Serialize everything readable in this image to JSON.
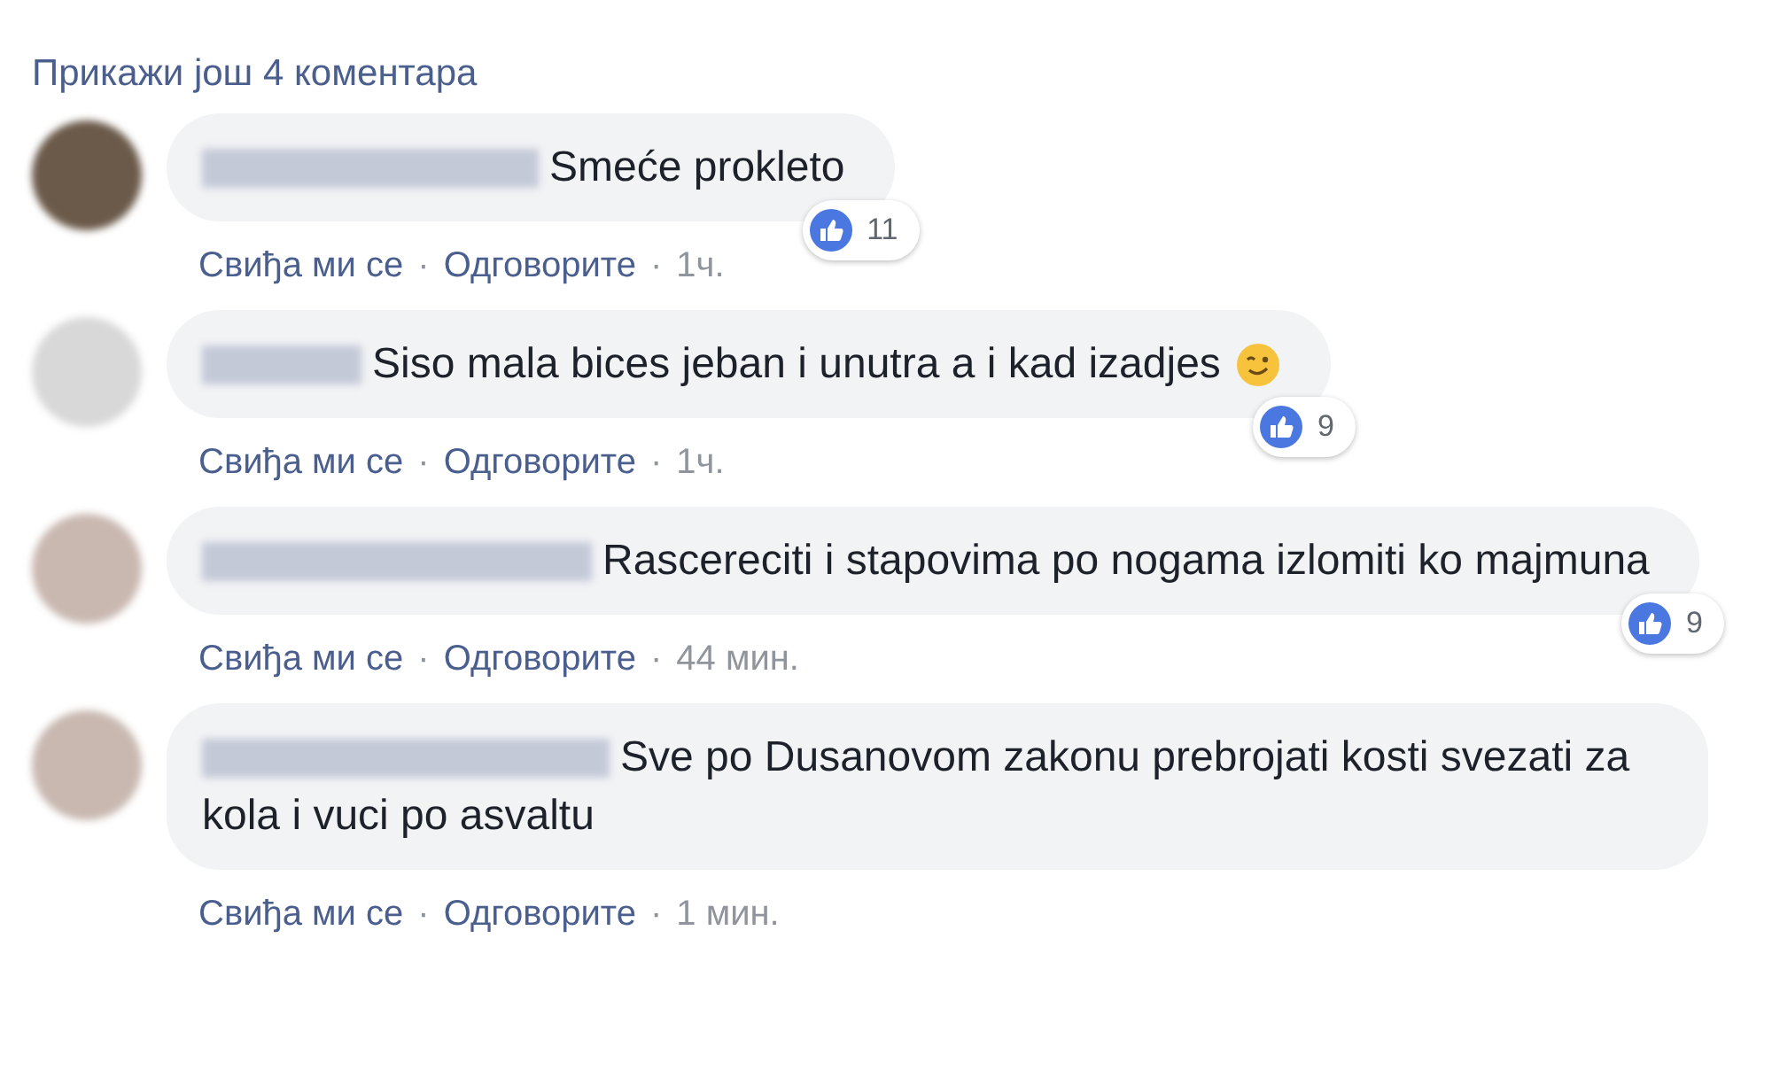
{
  "more_comments": "Прикажи још 4 коментара",
  "comments": [
    {
      "text": "Smeće prokleto",
      "wink_emoji": false,
      "likes": "11",
      "actions": [
        {
          "kind": "link",
          "text": "Свиђа ми се"
        },
        {
          "kind": "dot",
          "text": "·"
        },
        {
          "kind": "link",
          "text": "Одговорите"
        },
        {
          "kind": "dot",
          "text": "·"
        },
        {
          "kind": "time",
          "text": "1ч."
        }
      ]
    },
    {
      "text": "Siso mala bices jeban i unutra a i kad izadjes",
      "wink_emoji": true,
      "likes": "9",
      "actions": [
        {
          "kind": "link",
          "text": "Свиђа ми се"
        },
        {
          "kind": "dot",
          "text": "·"
        },
        {
          "kind": "link",
          "text": "Одговорите"
        },
        {
          "kind": "dot",
          "text": "·"
        },
        {
          "kind": "time",
          "text": "1ч."
        }
      ]
    },
    {
      "text": "Rascereciti i stapovima po nogama izlomiti ko majmuna",
      "wink_emoji": false,
      "likes": "9",
      "actions": [
        {
          "kind": "link",
          "text": "Свиђа ми се"
        },
        {
          "kind": "dot",
          "text": "·"
        },
        {
          "kind": "link",
          "text": "Одговорите"
        },
        {
          "kind": "dot",
          "text": "·"
        },
        {
          "kind": "time",
          "text": "44 мин."
        }
      ]
    },
    {
      "text": "Sve po Dusanovom zakonu prebrojati kosti svezati za kola i vuci po asvaltu",
      "wink_emoji": false,
      "actions": [
        {
          "kind": "link",
          "text": "Свиђа ми се"
        },
        {
          "kind": "dot",
          "text": "·"
        },
        {
          "kind": "link",
          "text": "Одговорите"
        },
        {
          "kind": "dot",
          "text": "·"
        },
        {
          "kind": "time",
          "text": "1 мин."
        }
      ]
    }
  ]
}
